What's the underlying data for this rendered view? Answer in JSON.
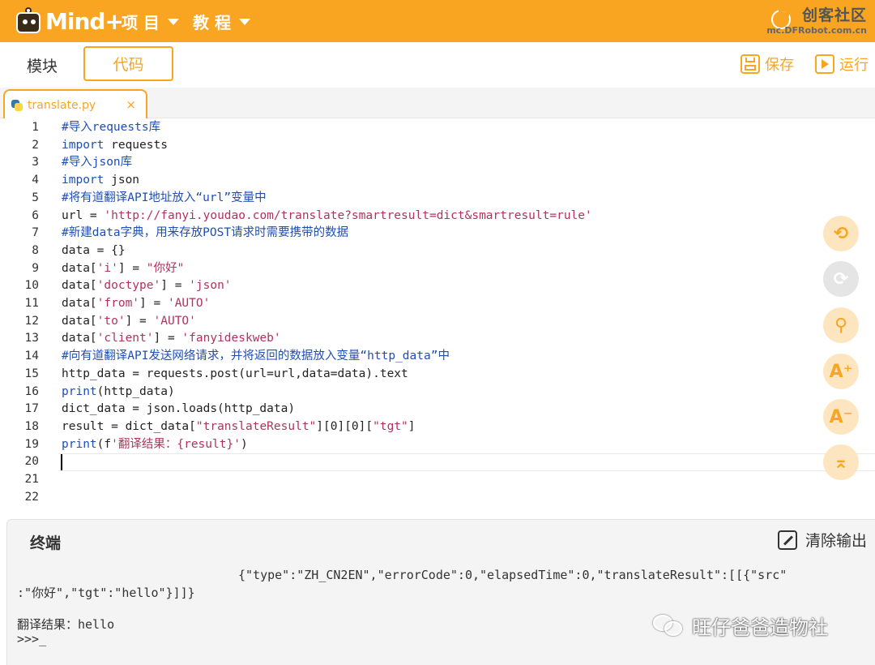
{
  "topbar": {
    "logo_text": "Mind+",
    "menu_project": "项 目",
    "menu_tutorial": "教 程",
    "brand_df": "DF",
    "brand_name": "创客社区",
    "brand_url": "mc.DFRobot.com.cn"
  },
  "toolbar": {
    "tab_modules": "模块",
    "tab_code": "代码",
    "save_label": "保存",
    "run_label": "运行"
  },
  "file_tab": {
    "name": "translate.py",
    "close": "×"
  },
  "editor": {
    "active_line": 20,
    "lines": [
      {
        "n": "1",
        "parts": [
          {
            "t": "#导入requests库",
            "c": "c-com"
          }
        ]
      },
      {
        "n": "2",
        "parts": [
          {
            "t": "import",
            "c": "c-kw"
          },
          {
            "t": " requests",
            "c": "c-def"
          }
        ]
      },
      {
        "n": "3",
        "parts": [
          {
            "t": "#导入json库",
            "c": "c-com"
          }
        ]
      },
      {
        "n": "4",
        "parts": [
          {
            "t": "import",
            "c": "c-kw"
          },
          {
            "t": " json",
            "c": "c-def"
          }
        ]
      },
      {
        "n": "5",
        "parts": [
          {
            "t": "#将有道翻译API地址放入“url”变量中",
            "c": "c-com"
          }
        ]
      },
      {
        "n": "6",
        "parts": [
          {
            "t": "url = ",
            "c": "c-def"
          },
          {
            "t": "'http://fanyi.youdao.com/translate?smartresult=dict&smartresult=rule'",
            "c": "c-str"
          }
        ]
      },
      {
        "n": "7",
        "parts": [
          {
            "t": "#新建data字典，用来存放POST请求时需要携带的数据",
            "c": "c-com"
          }
        ]
      },
      {
        "n": "8",
        "parts": [
          {
            "t": "data = {}",
            "c": "c-def"
          }
        ]
      },
      {
        "n": "9",
        "parts": [
          {
            "t": "data[",
            "c": "c-def"
          },
          {
            "t": "'i'",
            "c": "c-str"
          },
          {
            "t": "] = ",
            "c": "c-def"
          },
          {
            "t": "\"你好\"",
            "c": "c-str"
          }
        ]
      },
      {
        "n": "10",
        "parts": [
          {
            "t": "data[",
            "c": "c-def"
          },
          {
            "t": "'doctype'",
            "c": "c-str"
          },
          {
            "t": "] = ",
            "c": "c-def"
          },
          {
            "t": "'json'",
            "c": "c-str"
          }
        ]
      },
      {
        "n": "11",
        "parts": [
          {
            "t": "data[",
            "c": "c-def"
          },
          {
            "t": "'from'",
            "c": "c-str"
          },
          {
            "t": "] = ",
            "c": "c-def"
          },
          {
            "t": "'AUTO'",
            "c": "c-str"
          }
        ]
      },
      {
        "n": "12",
        "parts": [
          {
            "t": "data[",
            "c": "c-def"
          },
          {
            "t": "'to'",
            "c": "c-str"
          },
          {
            "t": "] = ",
            "c": "c-def"
          },
          {
            "t": "'AUTO'",
            "c": "c-str"
          }
        ]
      },
      {
        "n": "13",
        "parts": [
          {
            "t": "data[",
            "c": "c-def"
          },
          {
            "t": "'client'",
            "c": "c-str"
          },
          {
            "t": "] = ",
            "c": "c-def"
          },
          {
            "t": "'fanyideskweb'",
            "c": "c-str"
          }
        ]
      },
      {
        "n": "14",
        "parts": [
          {
            "t": "#向有道翻译API发送网络请求，并将返回的数据放入变量“http_data”中",
            "c": "c-com"
          }
        ]
      },
      {
        "n": "15",
        "parts": [
          {
            "t": "http_data = requests.post(url=url,data=data).text",
            "c": "c-def"
          }
        ]
      },
      {
        "n": "16",
        "parts": [
          {
            "t": "print",
            "c": "c-kw"
          },
          {
            "t": "(http_data)",
            "c": "c-def"
          }
        ]
      },
      {
        "n": "17",
        "parts": [
          {
            "t": "dict_data = json.loads(http_data)",
            "c": "c-def"
          }
        ]
      },
      {
        "n": "18",
        "parts": [
          {
            "t": "result = dict_data[",
            "c": "c-def"
          },
          {
            "t": "\"translateResult\"",
            "c": "c-str"
          },
          {
            "t": "][0][0][",
            "c": "c-def"
          },
          {
            "t": "\"tgt\"",
            "c": "c-str"
          },
          {
            "t": "]",
            "c": "c-def"
          }
        ]
      },
      {
        "n": "19",
        "parts": [
          {
            "t": "print",
            "c": "c-kw"
          },
          {
            "t": "(f",
            "c": "c-def"
          },
          {
            "t": "'翻译结果：{result}'",
            "c": "c-str"
          },
          {
            "t": ")",
            "c": "c-def"
          }
        ]
      },
      {
        "n": "20",
        "parts": []
      },
      {
        "n": "21",
        "parts": []
      },
      {
        "n": "22",
        "parts": []
      }
    ]
  },
  "side_buttons": [
    {
      "name": "undo-icon",
      "glyph": "⟲",
      "grey": false
    },
    {
      "name": "redo-icon",
      "glyph": "⟳",
      "grey": true
    },
    {
      "name": "search-icon",
      "glyph": "⚲",
      "grey": false
    },
    {
      "name": "font-increase-icon",
      "glyph": "A⁺",
      "grey": false
    },
    {
      "name": "font-decrease-icon",
      "glyph": "A⁻",
      "grey": false
    },
    {
      "name": "scroll-top-icon",
      "glyph": "⌅",
      "grey": false
    }
  ],
  "terminal": {
    "title": "终端",
    "clear_label": "清除输出",
    "output_line1": "{\"type\":\"ZH_CN2EN\",\"errorCode\":0,\"elapsedTime\":0,\"translateResult\":[[{\"src\"",
    "output_line2": ":\"你好\",\"tgt\":\"hello\"}]]}",
    "output_line3": "翻译结果：hello",
    "prompt": ">>>_"
  },
  "watermark": {
    "text": "旺仔爸爸造物社"
  }
}
